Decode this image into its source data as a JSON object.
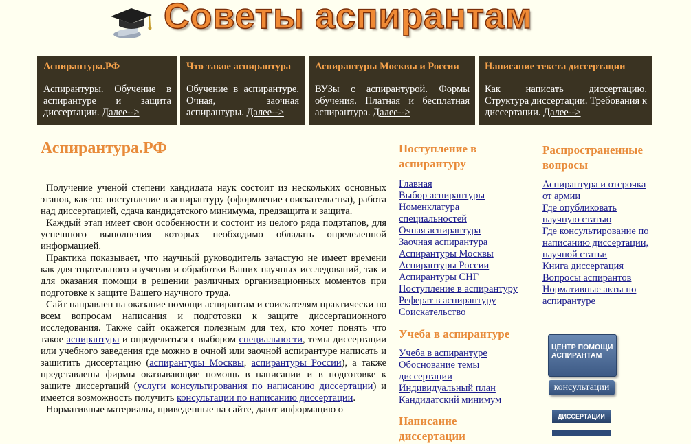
{
  "header": {
    "title": "Советы аспирантам"
  },
  "topnav": [
    {
      "title": "Аспирантура.РФ",
      "text": "Аспирантуры. Обучение в аспирантуре и защита диссертации.",
      "more": "Далее-->"
    },
    {
      "title": "Что такое аспирантура",
      "text": "Обучение в аспирантуре. Очная, заочная аспирантуры.",
      "more": "Далее-->"
    },
    {
      "title": "Аспирантуры Москвы и России",
      "text": "ВУЗы с аспирантурой. Формы обучения. Платная и бесплатная аспирантура.",
      "more": "Далее-->"
    },
    {
      "title": "Написание текста диссертации",
      "text": "Как написать диссертацию. Структура диссертации. Требования к диссертации.",
      "more": "Далее-->"
    }
  ],
  "main": {
    "title": "Аспирантура.РФ",
    "p1": "Получение ученой степени кандидата наук состоит из нескольких основных этапов, как-то: поступление в аспирантуру (оформление соискательства), работа над диссертацией, сдача кандидатского минимума, предзащита и защита.",
    "p2": "Каждый этап имеет свои особенности и состоит из целого ряда подэтапов, для успешного выполнения которых необходимо обладать определенной информацией.",
    "p3": "Практика показывает, что научный руководитель зачастую не имеет времени как для тщательного изучения и обработки Ваших научных исследований, так и для оказания помощи в решении различных организационных моментов при подготовке к защите Вашего научного труда.",
    "p4_a": "Сайт направлен на оказание помощи аспирантам и соискателям практически по всем вопросам написания и подготовки к защите диссертационного исследования. Также сайт окажется полезным для тех, кто хочет понять что такое",
    "link_aspirantura": "аспирантура",
    "p4_b": "и определиться с выбором",
    "link_specialnosti": "специальности",
    "p4_c": ", темы диссертации или учебного заведения где можно в очной или заочной аспирантуре написать и защитить диссертацию (",
    "link_moscow": "аспирантуры Москвы",
    "p4_d": ",",
    "link_russia": "аспирантуры России",
    "p4_e": "), а также представлены фирмы оказывающие помощь в написании и в подготовке к защите диссертаций (",
    "link_uslugi": "услуги консультирования по написанию диссертации",
    "p4_f": ") и имеется возможность получить",
    "link_konsult": "консультации по написанию диссертации",
    "p4_g": ".",
    "p5": "Нормативные материалы, приведенные на сайте, дают информацию о"
  },
  "col2": {
    "section1": "Поступление в аспирантуру",
    "links1": [
      "Главная",
      "Выбор аспирантуры",
      "Номенклатура специальностей",
      "Очная аспирантура",
      "Заочная аспирантура",
      "Аспирантуры Москвы",
      "Аспирантуры России",
      "Аспирантуры СНГ",
      "Поступление в аспирантуру",
      "Реферат в аспирантуру",
      "Соискательство"
    ],
    "section2": "Учеба в аспирантуре",
    "links2": [
      "Учеба в аспирантуре",
      "Обоснование темы диссертации",
      "Индивидуальный план",
      "Кандидатский минимум"
    ],
    "section3": "Написание диссертации"
  },
  "col3": {
    "section1": "Распространенные вопросы",
    "links1": [
      "Аспирантура и отсрочка от армии",
      "Где опубликовать научную статью",
      "Где консультирование по написанию диссертации, научной статьи",
      "Книга диссертация",
      "Вопросы аспирантов",
      "Нормативные акты по аспирантуре"
    ],
    "badge1": "ЦЕНТР ПОМОЩИ АСПИРАНТАМ",
    "badge2": "консультации",
    "badge3": "ДИССЕРТАЦИИ"
  },
  "colors": {
    "accent": "#e88b3a",
    "box": "#3a3322",
    "link": "#1a1a8c",
    "bg": "#fffff0"
  }
}
